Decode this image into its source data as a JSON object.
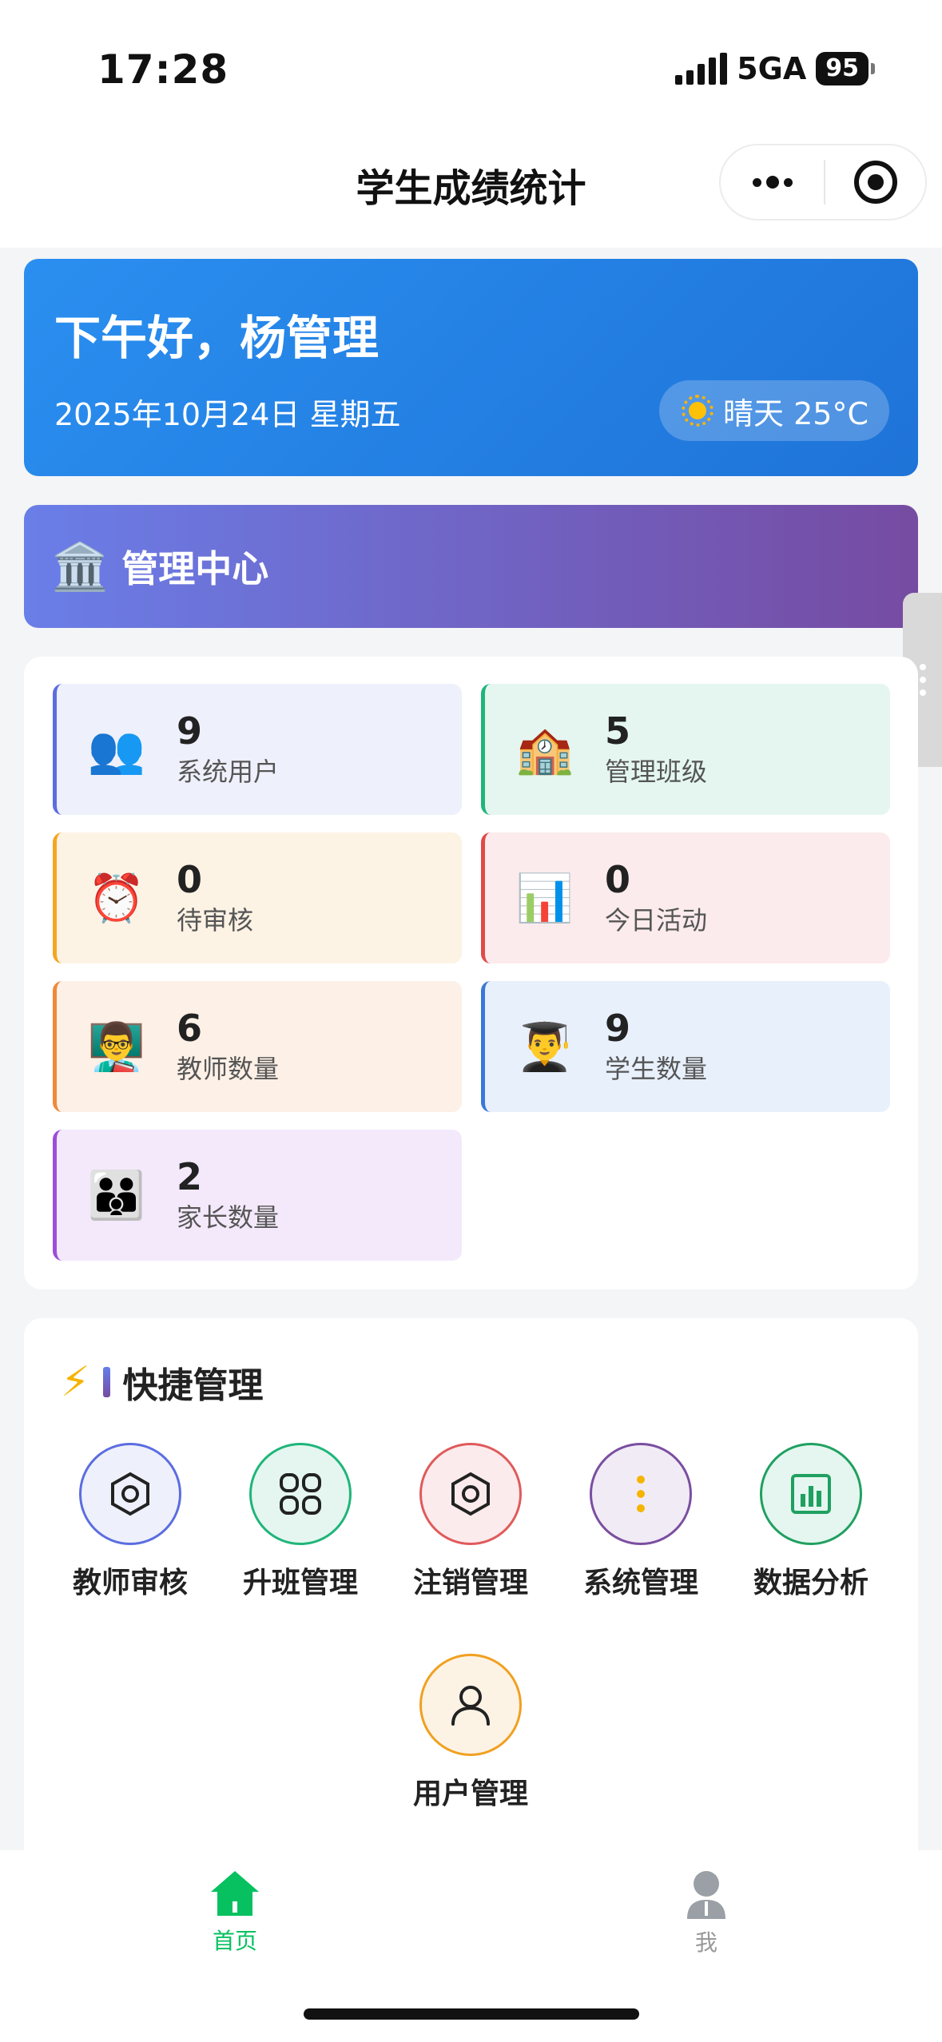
{
  "status_bar": {
    "time": "17:28",
    "network": "5GA",
    "battery": "95"
  },
  "nav": {
    "title": "学生成绩统计"
  },
  "greeting": {
    "title": "下午好，杨管理",
    "date": "2025年10月24日 星期五",
    "weather": "晴天 25°C"
  },
  "admin": {
    "icon": "🏛️",
    "title": "管理中心"
  },
  "stats": [
    {
      "icon": "👥",
      "value": "9",
      "label": "系统用户",
      "accent": "#5b6de0",
      "bg": "#eef0fb"
    },
    {
      "icon": "🏫",
      "value": "5",
      "label": "管理班级",
      "accent": "#1fb57a",
      "bg": "#e4f6ef"
    },
    {
      "icon": "⏰",
      "value": "0",
      "label": "待审核",
      "accent": "#f5a623",
      "bg": "#fdf3e5"
    },
    {
      "icon": "📊",
      "value": "0",
      "label": "今日活动",
      "accent": "#e04a4a",
      "bg": "#fcebec"
    },
    {
      "icon": "👨‍🏫",
      "value": "6",
      "label": "教师数量",
      "accent": "#f0883a",
      "bg": "#fdf0e6"
    },
    {
      "icon": "👨‍🎓",
      "value": "9",
      "label": "学生数量",
      "accent": "#3a78d8",
      "bg": "#e8f0fc"
    },
    {
      "icon": "👪",
      "value": "2",
      "label": "家长数量",
      "accent": "#9b4fd8",
      "bg": "#f3e9fb"
    }
  ],
  "quick": {
    "title": "快捷管理",
    "items": [
      {
        "label": "教师审核",
        "icon": "hexagon-settings-icon",
        "color": "#5b6de0",
        "bg": "#eef0fb"
      },
      {
        "label": "升班管理",
        "icon": "grid-apps-icon",
        "color": "#1fb57a",
        "bg": "#e4f6ef"
      },
      {
        "label": "注销管理",
        "icon": "hexagon-settings-icon",
        "color": "#e05a5a",
        "bg": "#fcebec"
      },
      {
        "label": "系统管理",
        "icon": "vertical-dots-icon",
        "color": "#7a4ea0",
        "bg": "#f1ebf6"
      },
      {
        "label": "数据分析",
        "icon": "chart-box-icon",
        "color": "#1fa060",
        "bg": "#e4f6ef"
      },
      {
        "label": "用户管理",
        "icon": "user-icon",
        "color": "#f0a020",
        "bg": "#fdf3e5"
      }
    ]
  },
  "tabs": [
    {
      "label": "首页",
      "active": true,
      "color": "#07c160"
    },
    {
      "label": "我",
      "active": false,
      "color": "#999999"
    }
  ]
}
